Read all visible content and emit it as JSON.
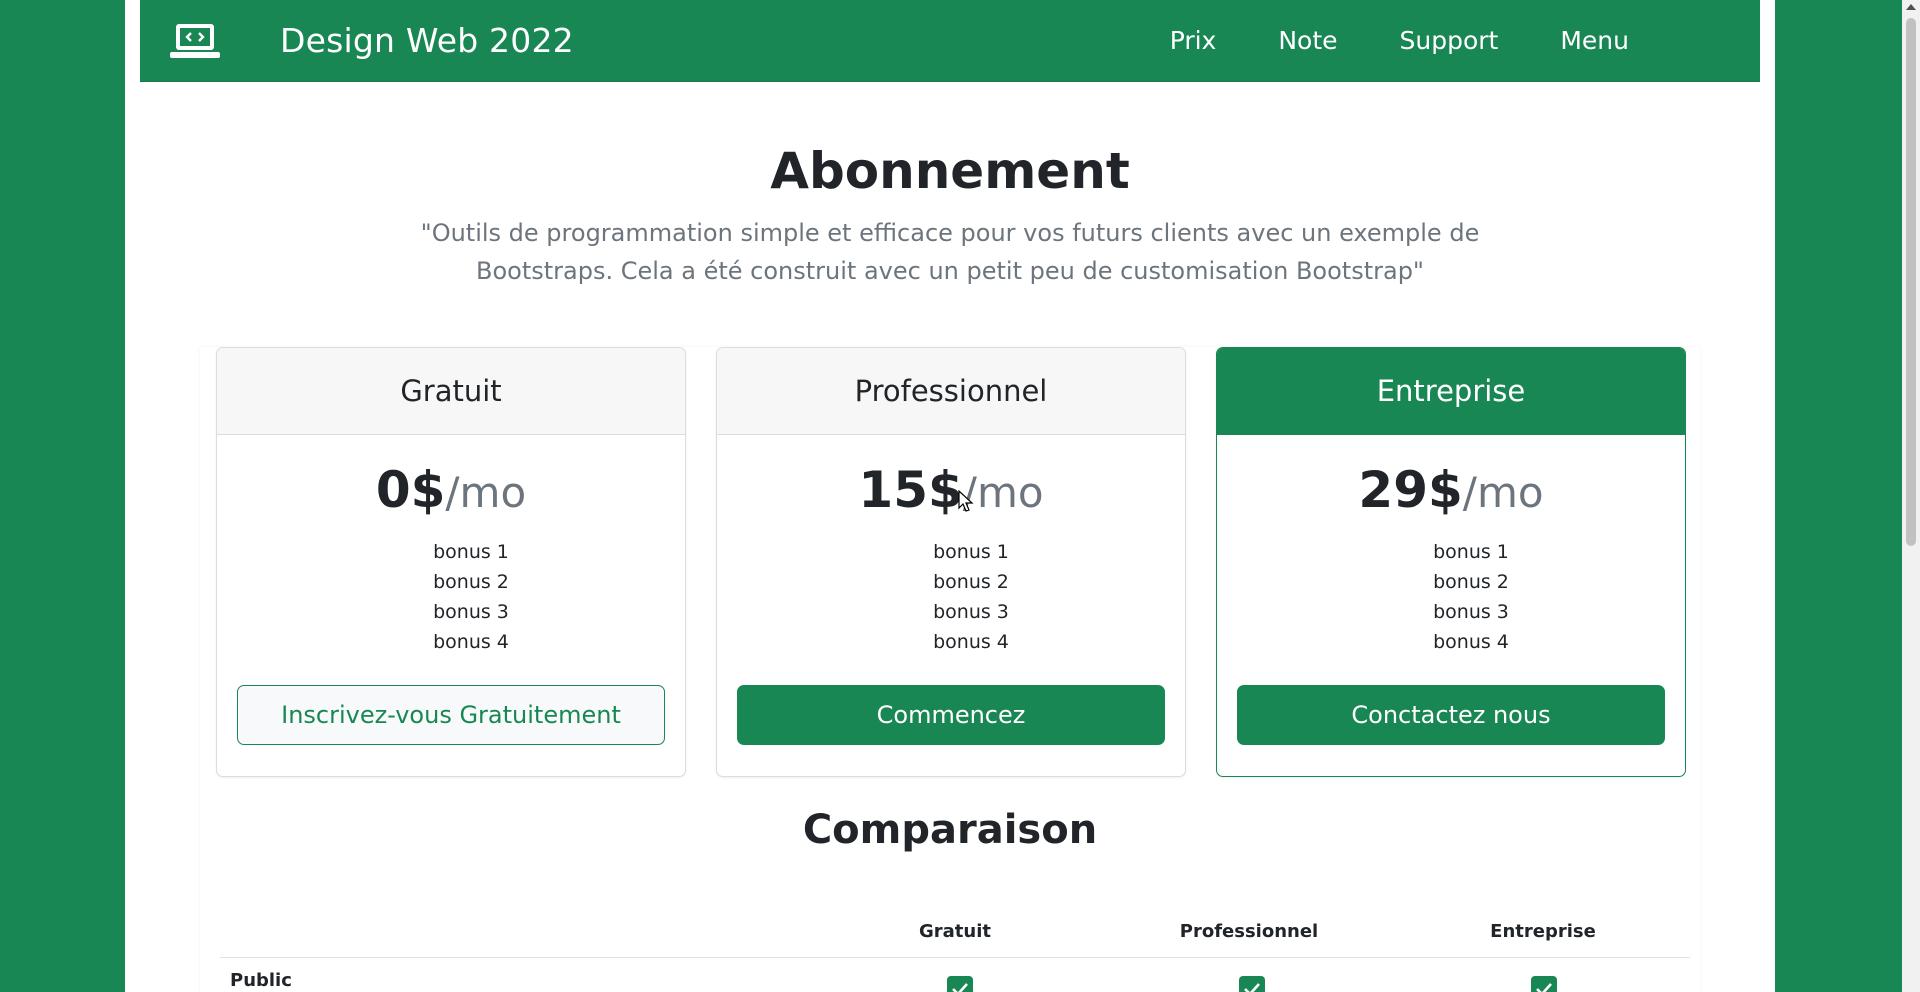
{
  "navbar": {
    "brand": "Design Web 2022",
    "logo_icon": "laptop-code-icon",
    "links": [
      "Prix",
      "Note",
      "Support",
      "Menu"
    ]
  },
  "hero": {
    "title": "Abonnement",
    "subtitle": "\"Outils de programmation simple et efficace pour vos futurs clients avec un exemple de Bootstraps. Cela a été construit avec un petit peu de customisation Bootstrap\""
  },
  "plans": [
    {
      "name": "Gratuit",
      "amount": "0$",
      "per": "/mo",
      "features": [
        "bonus 1",
        "bonus 2",
        "bonus 3",
        "bonus 4"
      ],
      "button": "Inscrivez-vous Gratuitement"
    },
    {
      "name": "Professionnel",
      "amount": "15$",
      "per": "/mo",
      "features": [
        "bonus 1",
        "bonus 2",
        "bonus 3",
        "bonus 4"
      ],
      "button": "Commencez"
    },
    {
      "name": "Entreprise",
      "amount": "29$",
      "per": "/mo",
      "features": [
        "bonus 1",
        "bonus 2",
        "bonus 3",
        "bonus 4"
      ],
      "button": "Conctactez nous"
    }
  ],
  "comparison": {
    "title": "Comparaison",
    "columns": [
      "Gratuit",
      "Professionnel",
      "Entreprise"
    ],
    "rows": [
      {
        "label": "Public",
        "values": [
          true,
          true,
          true
        ]
      }
    ]
  },
  "colors": {
    "brand": "#198754",
    "muted": "#6c757d"
  }
}
